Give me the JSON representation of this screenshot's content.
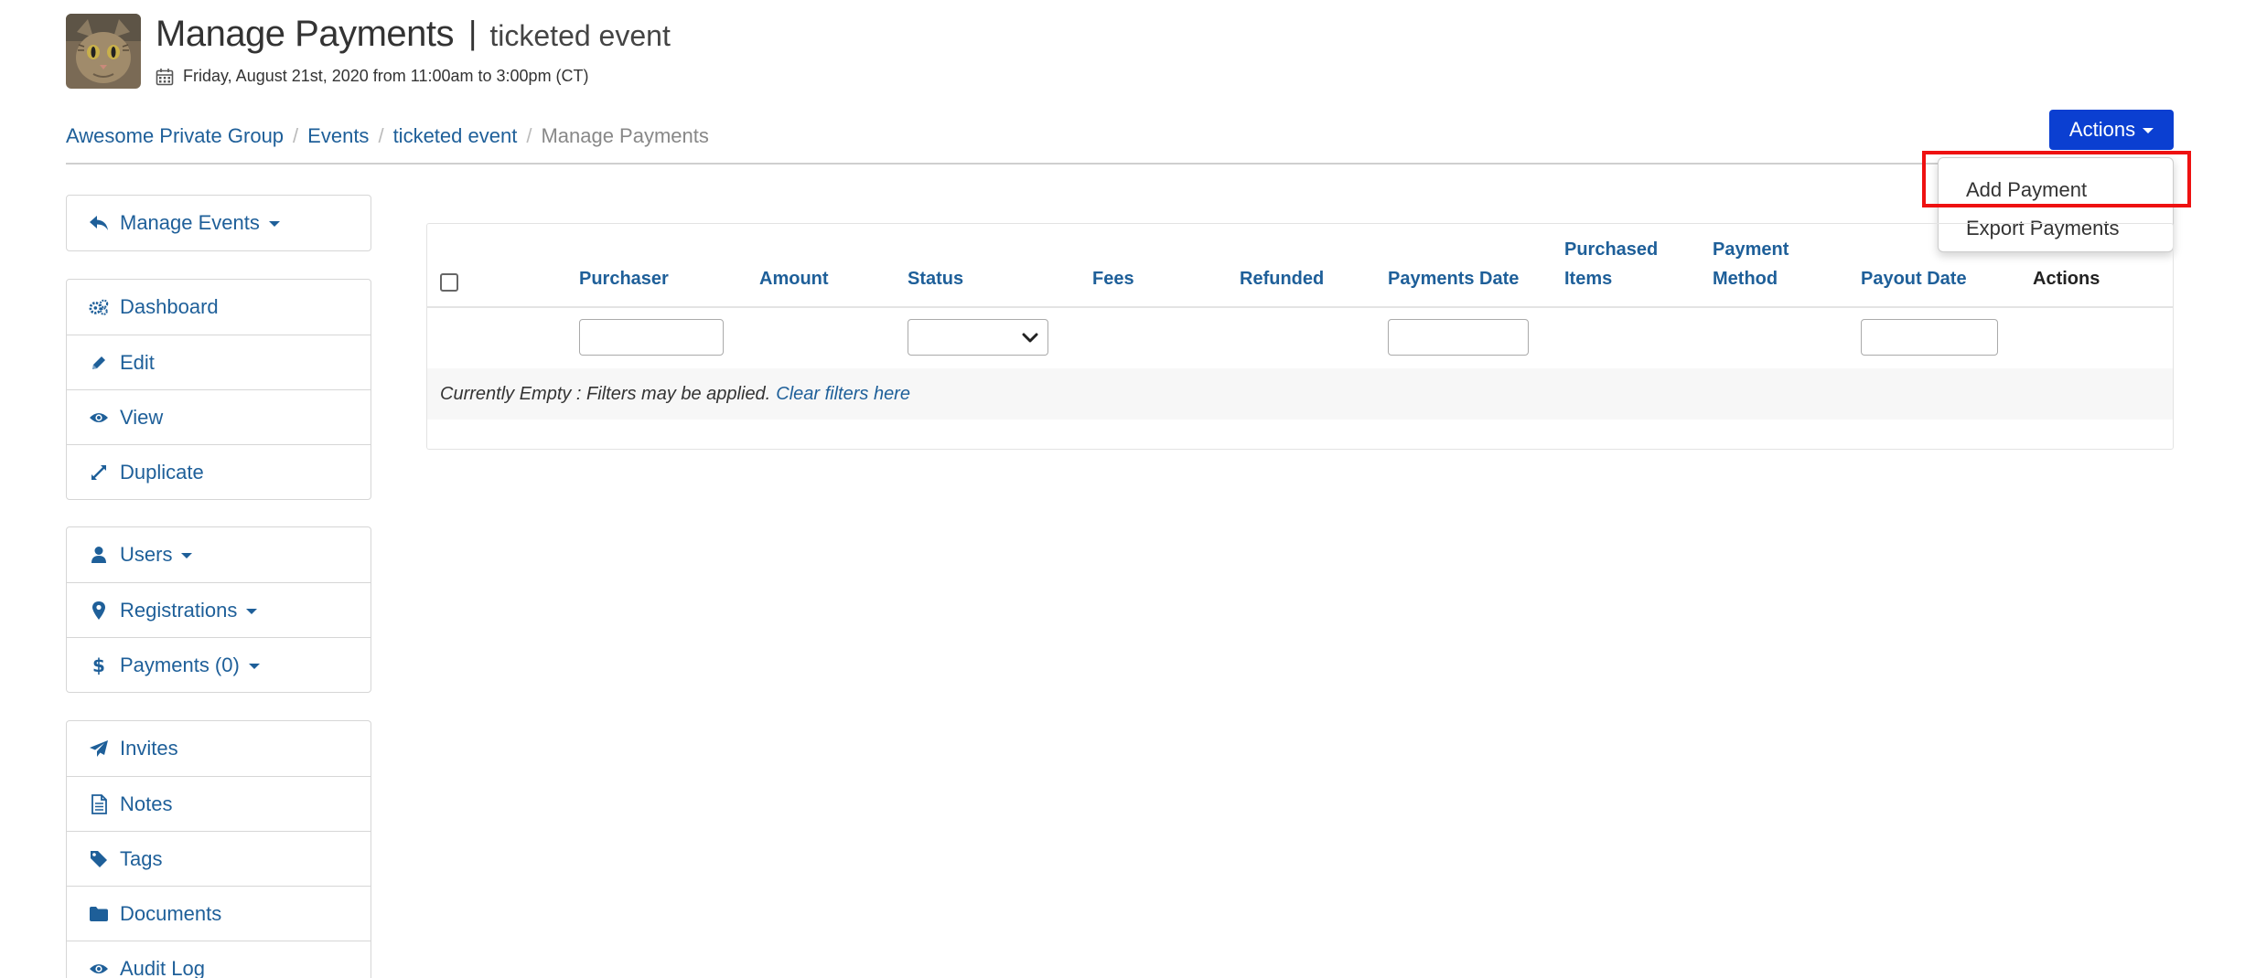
{
  "header": {
    "title": "Manage Payments",
    "separator": "|",
    "event_name": "ticketed event",
    "date_text": "Friday, August 21st, 2020 from 11:00am to 3:00pm (CT)"
  },
  "breadcrumb": {
    "items": [
      "Awesome Private Group",
      "Events",
      "ticketed event"
    ],
    "separator": "/",
    "current": "Manage Payments"
  },
  "actions": {
    "label": "Actions",
    "menu": [
      "Add Payment",
      "Export Payments"
    ]
  },
  "sidebar": {
    "manage_events": "Manage Events",
    "group1": [
      "Dashboard",
      "Edit",
      "View",
      "Duplicate"
    ],
    "group2": [
      "Users",
      "Registrations",
      "Payments (0)"
    ],
    "group3": [
      "Invites",
      "Notes",
      "Tags",
      "Documents",
      "Audit Log"
    ]
  },
  "table": {
    "columns": {
      "purchaser": "Purchaser",
      "amount": "Amount",
      "status": "Status",
      "fees": "Fees",
      "refunded": "Refunded",
      "payments_date": "Payments Date",
      "purchased_items_1": "Purchased",
      "purchased_items_2": "Items",
      "payment_method_1": "Payment",
      "payment_method_2": "Method",
      "payout_date": "Payout Date",
      "actions": "Actions"
    },
    "empty_text": "Currently Empty : Filters may be applied.",
    "clear_filters": "Clear filters here"
  },
  "colors": {
    "link": "#1e5f99",
    "primary_button": "#0b3fd1",
    "highlight": "#ee1111"
  }
}
